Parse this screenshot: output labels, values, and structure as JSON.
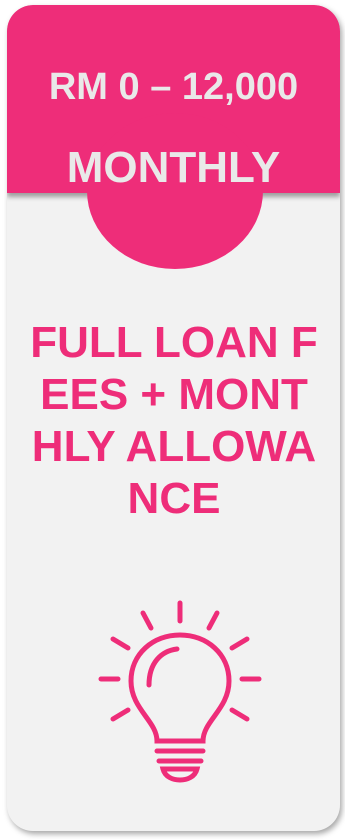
{
  "tier": {
    "range": "RM 0 – 12,000",
    "period": "MONTHLY",
    "benefit": "FULL LOAN FEES + MONTHLY ALLOWANCE",
    "accent_color": "#ee2d79",
    "header_text_color": "#e9e9e9",
    "icon": "lightbulb-icon"
  }
}
